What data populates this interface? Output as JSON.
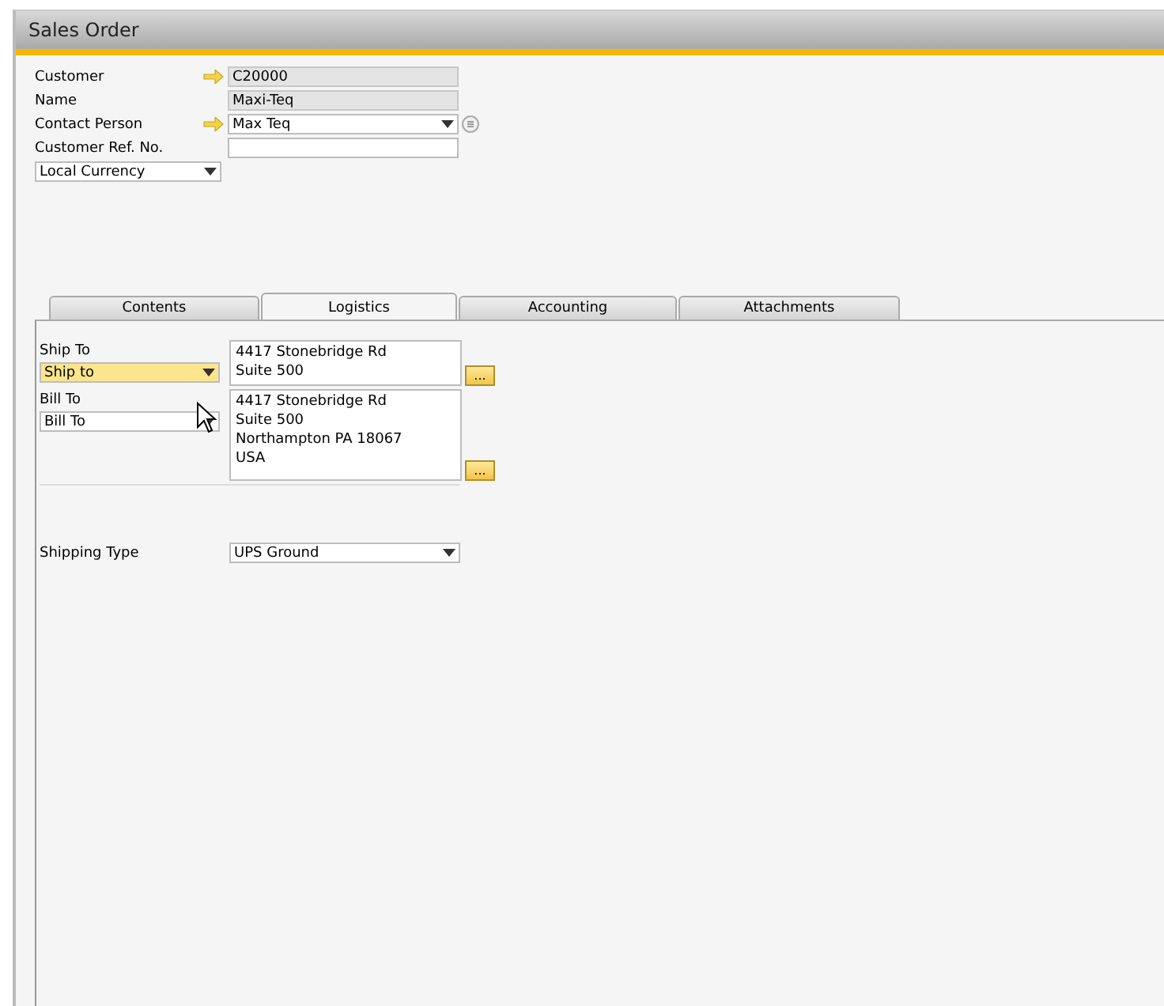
{
  "window": {
    "title": "Sales Order"
  },
  "header_fields": [
    {
      "label": "Customer",
      "value": "C20000",
      "kind": "link",
      "readonly": true
    },
    {
      "label": "Name",
      "value": "Maxi-Teq",
      "kind": "text",
      "readonly": true
    },
    {
      "label": "Contact Person",
      "value": "Max Teq",
      "kind": "linkselect",
      "readonly": false
    },
    {
      "label": "Customer Ref. No.",
      "kind": "text",
      "readonly": false
    }
  ],
  "currency": {
    "value": "Local Currency"
  },
  "tabs": [
    {
      "label": "Contents",
      "selected": false
    },
    {
      "label": "Logistics",
      "selected": true
    },
    {
      "label": "Accounting",
      "selected": false
    },
    {
      "label": "Attachments",
      "selected": false
    }
  ],
  "addresses": [
    {
      "label": "Ship To",
      "select": "Ship to",
      "highlighted": true,
      "lines": [
        "4417 Stonebridge Rd",
        "Suite 500"
      ],
      "button": "..."
    },
    {
      "label": "Bill To",
      "select": "Bill To",
      "highlighted": false,
      "lines": [
        "4417 Stonebridge Rd",
        "Suite 500",
        "Northampton PA  18067",
        "USA"
      ],
      "button": "..."
    }
  ],
  "shipping_type": {
    "label": "Shipping Type",
    "value": "UPS Ground"
  }
}
